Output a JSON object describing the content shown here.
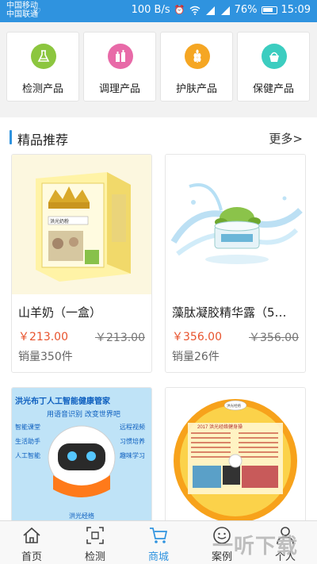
{
  "status_bar": {
    "carrier_1": "中国移动",
    "carrier_2": "中国联通",
    "net_speed": "100 B/s",
    "battery": "76%",
    "time": "15:09"
  },
  "categories": [
    {
      "label": "检测产品",
      "icon": "flask-icon",
      "color": "#8cc63f"
    },
    {
      "label": "调理产品",
      "icon": "bottles-icon",
      "color": "#e86aa8"
    },
    {
      "label": "护肤产品",
      "icon": "wheat-icon",
      "color": "#f5a623"
    },
    {
      "label": "保健产品",
      "icon": "basket-icon",
      "color": "#3ccdc0"
    }
  ],
  "section": {
    "title": "精品推荐",
    "more": "更多>"
  },
  "products": [
    {
      "name": "山羊奶（一盒）",
      "price": "￥213.00",
      "original_price": "￥213.00",
      "sales": "销量350件"
    },
    {
      "name": "藻肽凝胶精华露（5…",
      "price": "￥356.00",
      "original_price": "￥356.00",
      "sales": "销量26件"
    },
    {
      "banner_title": "洪光布丁人工智能健康管家",
      "banner_sub": "用语音识别 改变世界吧",
      "tags": [
        "智能课堂",
        "生活助手",
        "人工智能",
        "远程视频",
        "习惯培养",
        "趣味学习"
      ],
      "caption": "洪光经络"
    },
    {
      "disc_title": "2017 洪光经络健身操",
      "brand": "洪光经络"
    }
  ],
  "bottom_nav": [
    {
      "label": "首页",
      "icon": "home-icon"
    },
    {
      "label": "检测",
      "icon": "scan-icon"
    },
    {
      "label": "商城",
      "icon": "cart-icon",
      "active": true
    },
    {
      "label": "案例",
      "icon": "case-icon"
    },
    {
      "label": "个人",
      "icon": "user-icon"
    }
  ],
  "watermark": "一听下载"
}
